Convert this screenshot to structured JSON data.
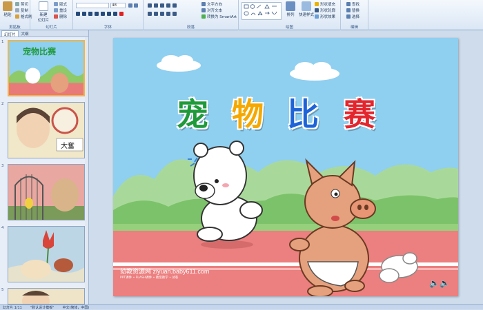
{
  "ribbon": {
    "clipboard": {
      "label": "剪贴板",
      "paste": "粘贴",
      "cut": "剪切",
      "copy": "复制",
      "format_painter": "格式刷"
    },
    "slides": {
      "label": "幻灯片",
      "new_slide": "新建\n幻灯片",
      "layout": "版式",
      "reset": "重设",
      "delete": "删除"
    },
    "font": {
      "label": "字体",
      "size": "48"
    },
    "paragraph": {
      "label": "段落",
      "text_direction": "文字方向",
      "align_text": "对齐文本",
      "smartart": "转换为 SmartArt"
    },
    "drawing": {
      "label": "绘图",
      "arrange": "排列",
      "quick_styles": "快速样式",
      "shape_fill": "形状填充",
      "shape_outline": "形状轮廓",
      "shape_effects": "形状效果"
    },
    "editing": {
      "label": "编辑",
      "find": "查找",
      "replace": "替换",
      "select": "选择"
    }
  },
  "left_panel": {
    "tabs": [
      "幻灯片",
      "大纲"
    ],
    "thumb_numbers": [
      "1",
      "2",
      "3",
      "4",
      "5"
    ],
    "thumb1_title": "宠物比赛",
    "thumb2_sign": "大奮"
  },
  "slide": {
    "title_chars": [
      "宠",
      "物",
      "比",
      "赛"
    ],
    "title_colors": [
      "#1f9a3a",
      "#f5a800",
      "#1e64d8",
      "#e3262e"
    ],
    "watermark": "幼教资源网 ziyuan.baby611.com",
    "watermark_sub": "PPT课件 • FLASH课件 • 教案教学 • 试卷"
  },
  "status": {
    "slide_info": "幻灯片 1/11",
    "theme": "\"默认设计模板\"",
    "language": "中文(简体，中国)"
  }
}
